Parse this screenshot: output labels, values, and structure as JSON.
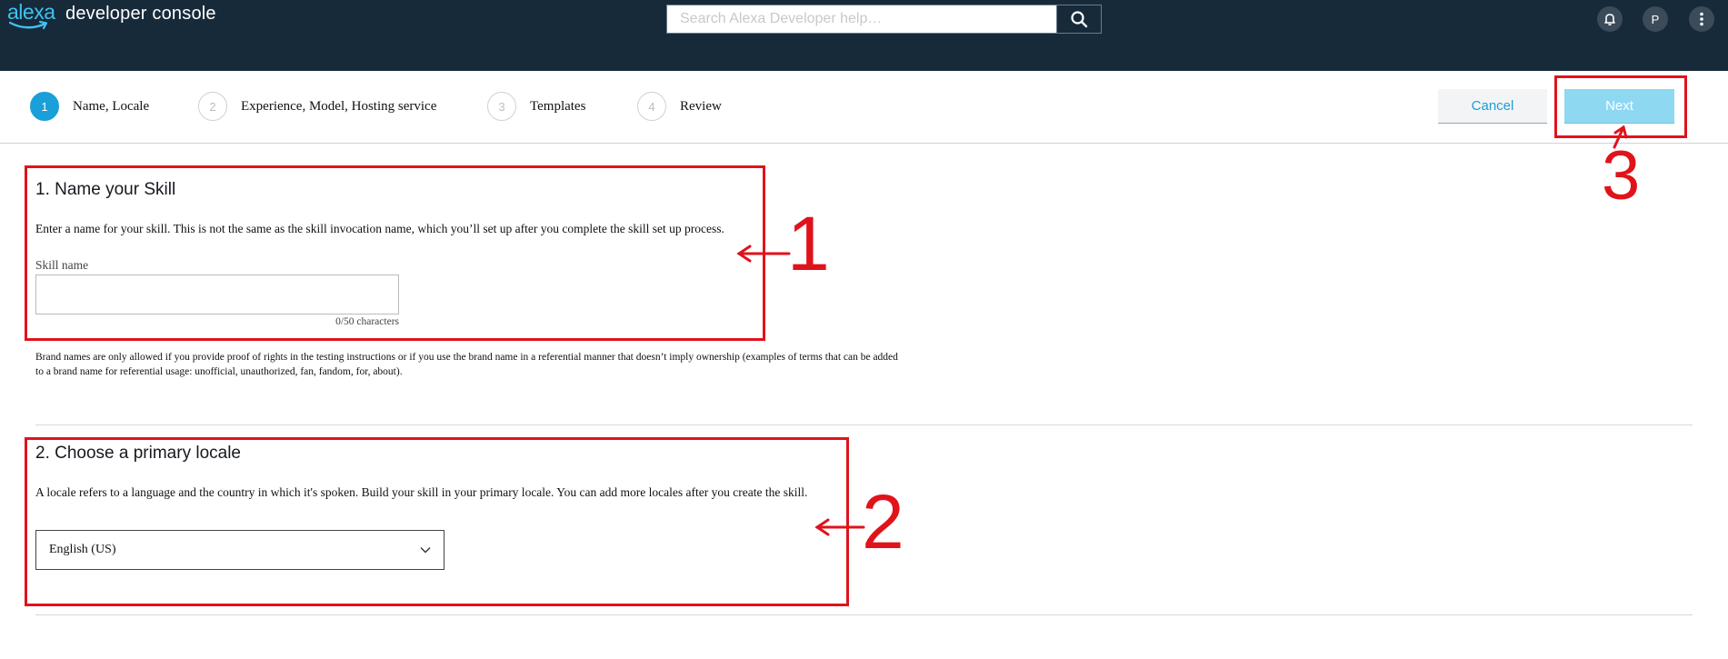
{
  "header": {
    "logo_word": "alexa",
    "title": "developer console",
    "search_placeholder": "Search Alexa Developer help…",
    "profile_initial": "P",
    "icons": [
      "search-icon",
      "bell-icon",
      "more-vertical-icon"
    ]
  },
  "stepper": {
    "steps": [
      {
        "number": "1",
        "label": "Name, Locale",
        "active": true
      },
      {
        "number": "2",
        "label": "Experience, Model, Hosting service",
        "active": false
      },
      {
        "number": "3",
        "label": "Templates",
        "active": false
      },
      {
        "number": "4",
        "label": "Review",
        "active": false
      }
    ],
    "cancel_label": "Cancel",
    "next_label": "Next"
  },
  "section1": {
    "title": "1. Name your Skill",
    "description": "Enter a name for your skill. This is not the same as the skill invocation name, which you’ll set up after you complete the skill set up process.",
    "field_label": "Skill name",
    "field_value": "",
    "char_count": "0/50 characters",
    "note_line1": "Brand names are only allowed if you provide proof of rights in the testing instructions or if you use the brand name in a referential manner that doesn’t imply ownership (examples of terms that can be added",
    "note_line2": "to a brand name for referential usage: unofficial, unauthorized, fan, fandom, for, about)."
  },
  "section2": {
    "title": "2. Choose a primary locale",
    "description": "A locale refers to a language and the country in which it's spoken. Build your skill in your primary locale. You can add more locales after you create the skill.",
    "locale_selected": "English (US)"
  },
  "annotations": {
    "labels": [
      "1",
      "2",
      "3"
    ],
    "color": "#e0131b"
  },
  "colors": {
    "header_bg": "#172a3a",
    "accent": "#1a9fd8",
    "next_disabled": "#8fd8f2"
  }
}
